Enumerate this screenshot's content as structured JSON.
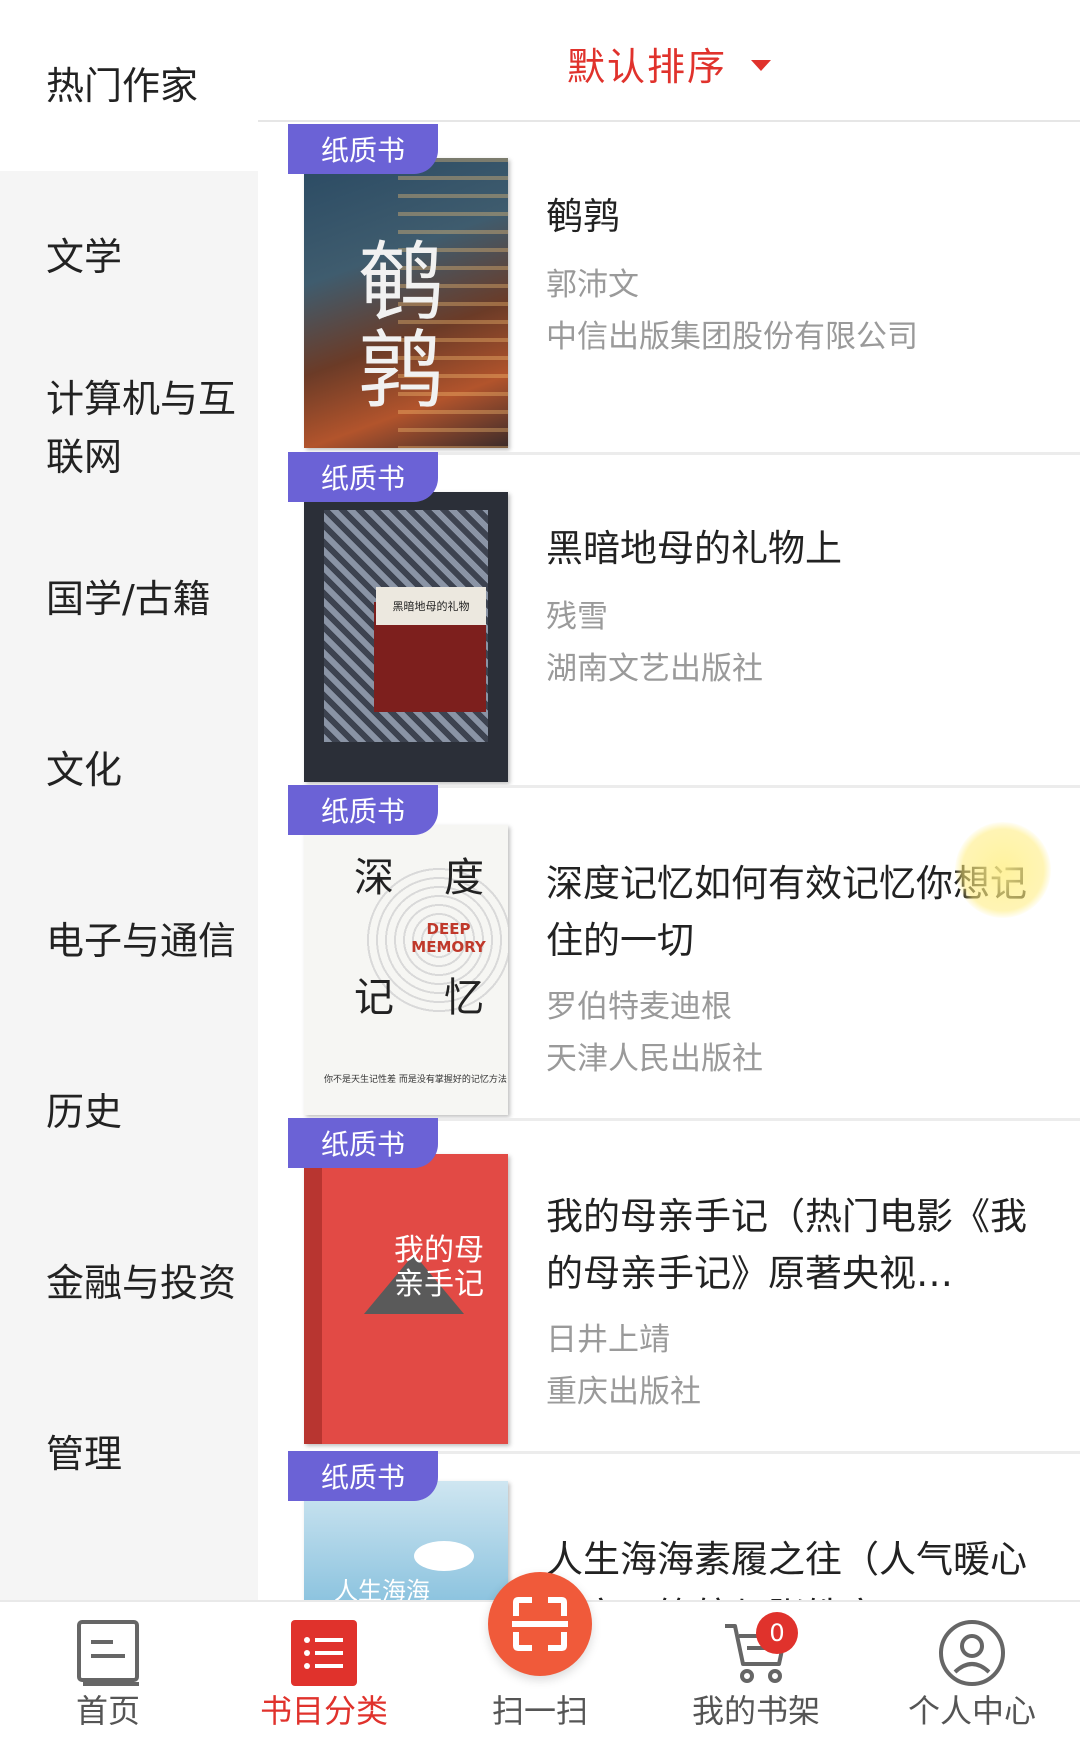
{
  "sort": {
    "label": "默认排序"
  },
  "sidebar": {
    "items": [
      {
        "label": "热门作家",
        "active": true
      },
      {
        "label": "文学"
      },
      {
        "label": "计算机与互联网"
      },
      {
        "label": "国学/古籍"
      },
      {
        "label": "文化"
      },
      {
        "label": "电子与通信"
      },
      {
        "label": "历史"
      },
      {
        "label": "金融与投资"
      },
      {
        "label": "管理"
      }
    ]
  },
  "books": [
    {
      "badge": "纸质书",
      "title": "鹌鹑",
      "author": "郭沛文",
      "publisher": "中信出版集团股份有限公司",
      "cover_text": "鹌鹑"
    },
    {
      "badge": "纸质书",
      "title": "黑暗地母的礼物上",
      "author": "残雪",
      "publisher": "湖南文艺出版社",
      "cover_text": "黑暗地母的礼物"
    },
    {
      "badge": "纸质书",
      "title": "深度记忆如何有效记忆你想记住的一切",
      "author": "罗伯特麦迪根",
      "publisher": "天津人民出版社",
      "cover_text": {
        "c1": "深",
        "c2": "度",
        "c3": "记",
        "c4": "忆",
        "en": "DEEP MEMORY",
        "foot": "你不是天生记性差 而是没有掌握好的记忆方法"
      }
    },
    {
      "badge": "纸质书",
      "title": "我的母亲手记（热门电影《我的母亲手记》原著央视…",
      "author": "日井上靖",
      "publisher": "重庆出版社",
      "cover_text": "我的母亲手记"
    },
    {
      "badge": "纸质书",
      "title": "人生海海素履之往（人气暖心作家云笺航与张皓宸",
      "author": "",
      "publisher": "",
      "cover_text": "人生海海"
    }
  ],
  "tabbar": {
    "items": [
      {
        "label": "首页",
        "icon": "home-doc-icon"
      },
      {
        "label": "书目分类",
        "icon": "list-icon",
        "active": true
      },
      {
        "label": "扫一扫",
        "icon": "scan-icon"
      },
      {
        "label": "我的书架",
        "icon": "cart-icon",
        "badge": "0"
      },
      {
        "label": "个人中心",
        "icon": "user-icon"
      }
    ]
  },
  "colors": {
    "accent": "#e0322c",
    "badge_bg": "#6b62d6",
    "scan_bg": "#f05a3a"
  }
}
